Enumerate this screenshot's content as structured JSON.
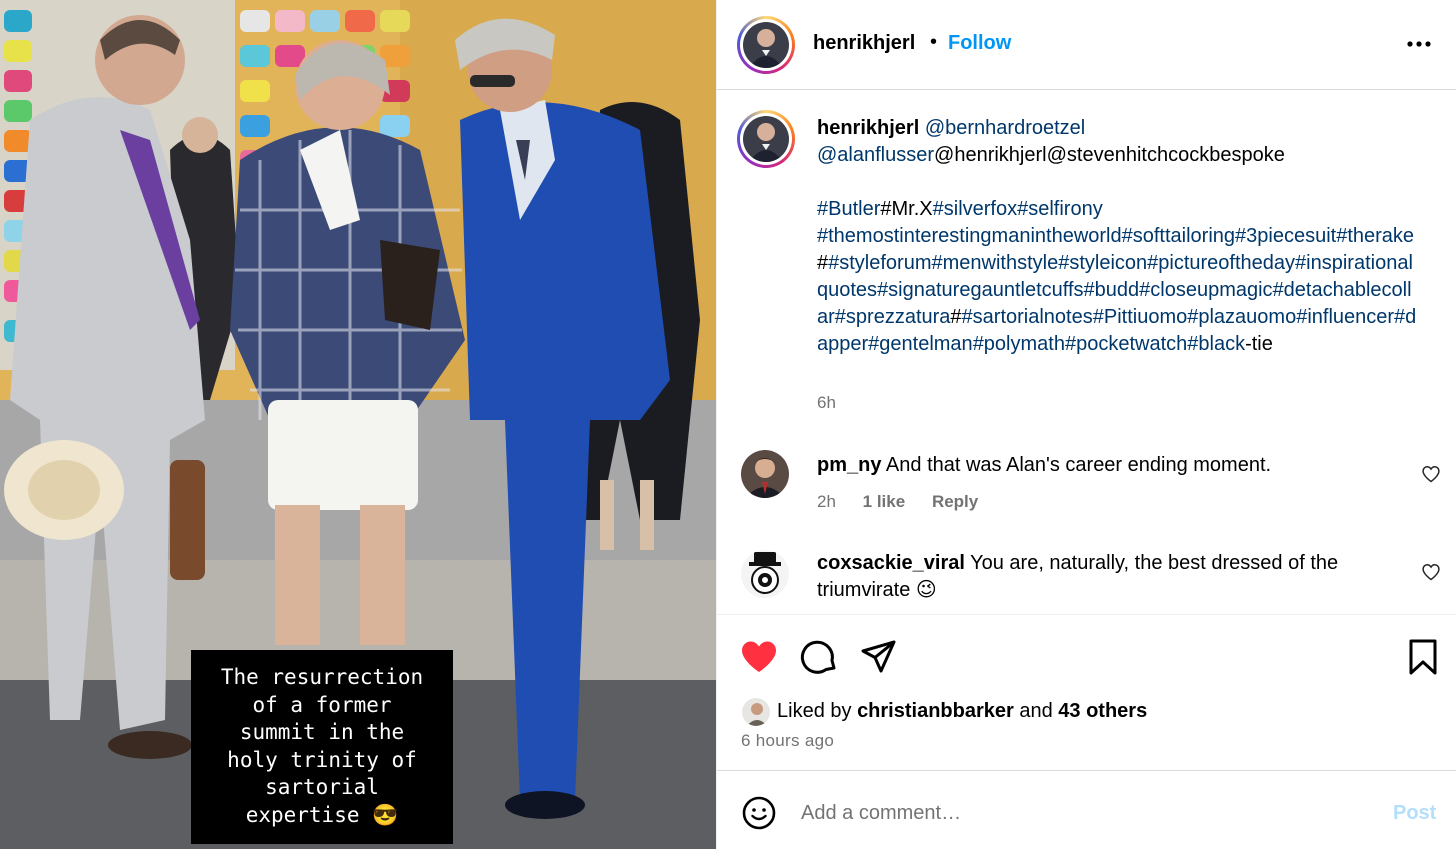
{
  "post_image": {
    "alt": "Three men in tailored outfits standing outdoors",
    "caption_overlay": {
      "lines": [
        "The resurrection",
        "of a former",
        "summit in the",
        "holy trinity of",
        "sartorial",
        "expertise 😎"
      ]
    }
  },
  "header": {
    "username": "henrikhjerl",
    "separator": "•",
    "follow_label": "Follow",
    "more_icon": "more-horizontal-icon"
  },
  "caption": {
    "username": "henrikhjerl",
    "mentions": [
      "@bernhardroetzel",
      "@alanflusser",
      "@henrikhjerl",
      "@stevenhitchcockbespoke"
    ],
    "hashtags": [
      "#Butler",
      "#Mr.X",
      "#silverfox",
      "#selfirony",
      "#themostinterestingmanintheworld",
      "#softtailoring",
      "#3piecesuit",
      "#therake",
      "#",
      "#styleforum",
      "#menwithstyle",
      "#styleicon",
      "#pictureoftheday",
      "#inspirationalquotes",
      "#signaturegauntletcuffs",
      "#budd",
      "#closeupmagic",
      "#detachablecollar",
      "#sprezzatura",
      "#",
      "#sartorialnotes",
      "#Pittiuomo",
      "#plazauomo",
      "#influencer",
      "#dapper",
      "#gentelman",
      "#polymath",
      "#pocketwatch",
      "#black"
    ],
    "trailing_text": "-tie",
    "time": "6h"
  },
  "comments": [
    {
      "username": "pm_ny",
      "text": "And that was Alan's career ending moment.",
      "time": "2h",
      "likes": "1 like",
      "reply_label": "Reply"
    },
    {
      "username": "coxsackie_viral",
      "text": "You are, naturally, the best dressed of the triumvirate 😉"
    }
  ],
  "actions": {
    "like_icon": "heart-filled-icon",
    "comment_icon": "comment-icon",
    "share_icon": "share-icon",
    "save_icon": "bookmark-icon"
  },
  "likes": {
    "prefix": "Liked by ",
    "user": "christianbbarker",
    "middle": " and ",
    "others": "43 others"
  },
  "posted_ago": "6 hours ago",
  "add_comment": {
    "placeholder": "Add a comment…",
    "post_label": "Post"
  },
  "colors": {
    "link": "#00376b",
    "follow": "#0095f6",
    "like_red": "#ff3040",
    "post_disabled": "#b2dffc",
    "muted": "#737373"
  }
}
